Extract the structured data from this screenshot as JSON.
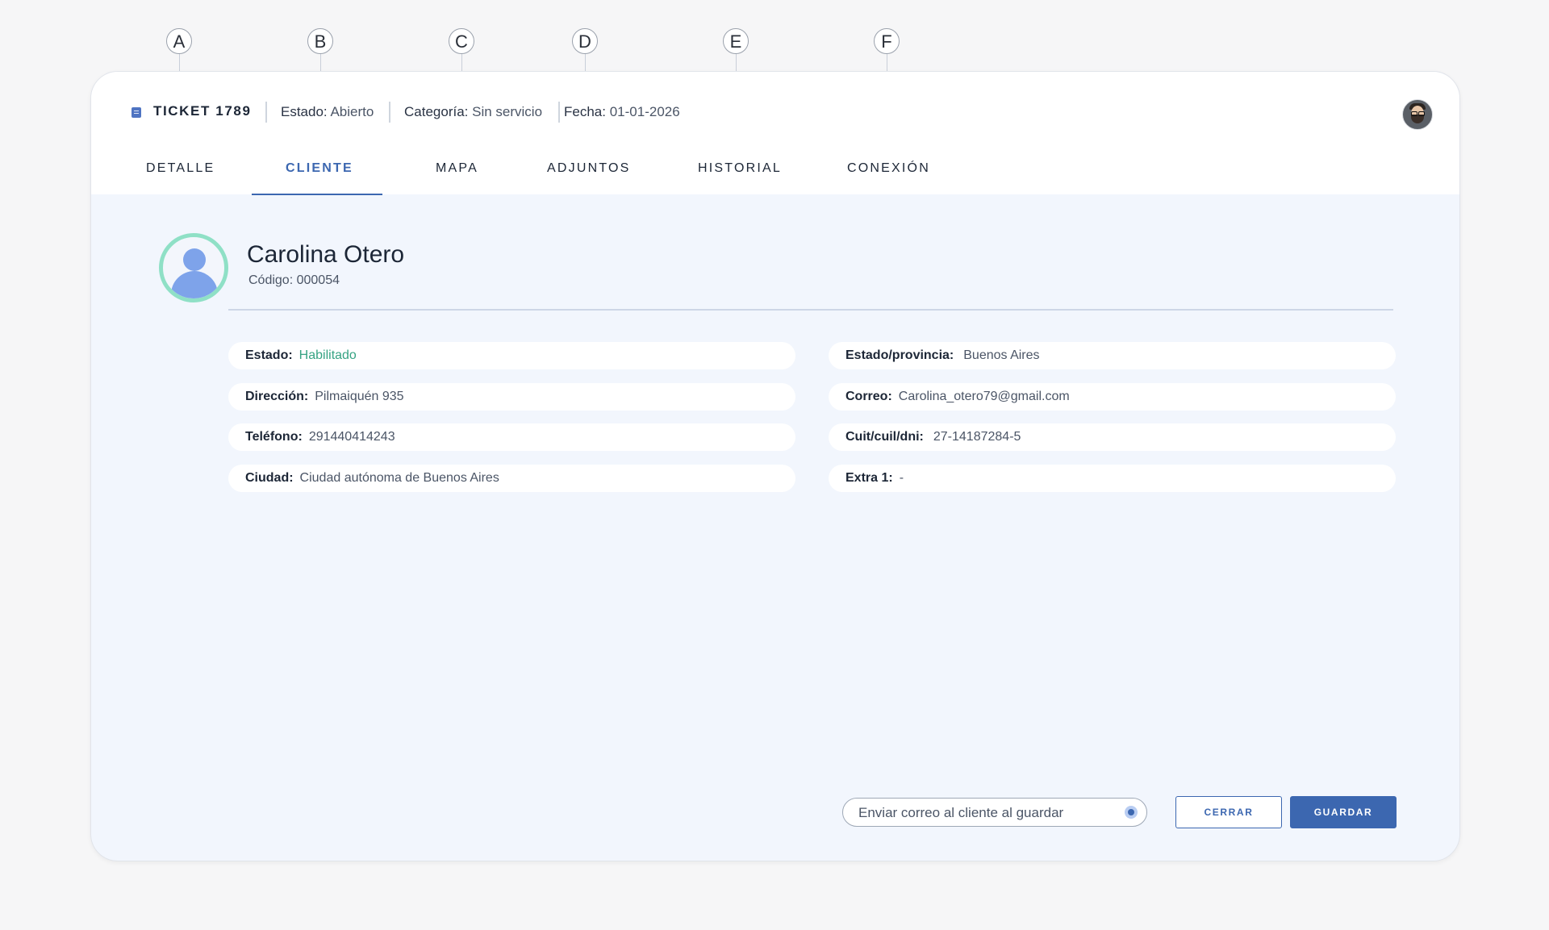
{
  "callouts": [
    "A",
    "B",
    "C",
    "D",
    "E",
    "F"
  ],
  "header": {
    "ticket_icon": "ticket-icon",
    "ticket_title": "TICKET 1789",
    "estado_label": "Estado:",
    "estado_value": "Abierto",
    "categoria_label": "Categoría:",
    "categoria_value": "Sin servicio",
    "fecha_label": "Fecha:",
    "fecha_value": "01-01-2026",
    "user_avatar_icon": "user-avatar"
  },
  "tabs": [
    {
      "label": "DETALLE"
    },
    {
      "label": "CLIENTE",
      "active": true
    },
    {
      "label": "MAPA"
    },
    {
      "label": "ADJUNTOS"
    },
    {
      "label": "HISTORIAL"
    },
    {
      "label": "CONEXIÓN"
    }
  ],
  "client": {
    "name": "Carolina Otero",
    "code": "Código: 000054",
    "avatar_icon": "person-icon"
  },
  "fields_left": [
    {
      "label": "Estado:",
      "value": "Habilitado",
      "value_color": "#36a383"
    },
    {
      "label": "Dirección:",
      "value": "Pilmaiquén 935"
    },
    {
      "label": "Teléfono:",
      "value": "291440414243"
    },
    {
      "label": "Ciudad:",
      "value": "Ciudad autónoma de Buenos Aires"
    }
  ],
  "fields_right": [
    {
      "label": "Estado/provincia:",
      "value": "Buenos Aires"
    },
    {
      "label": "Correo:",
      "value": "Carolina_otero79@gmail.com"
    },
    {
      "label": "Cuit/cuil/dni:",
      "value": "27-14187284-5"
    },
    {
      "label": "Extra 1:",
      "value": "-"
    }
  ],
  "footer": {
    "send_email_label": "Enviar correo al cliente al guardar",
    "send_email_checked": true,
    "close_label": "CERRAR",
    "save_label": "GUARDAR"
  },
  "colors": {
    "accent": "#3c67b0",
    "status_enabled": "#36a383",
    "avatar_ring": "#8fe0c6",
    "avatar_fill": "#7ea3ea"
  }
}
